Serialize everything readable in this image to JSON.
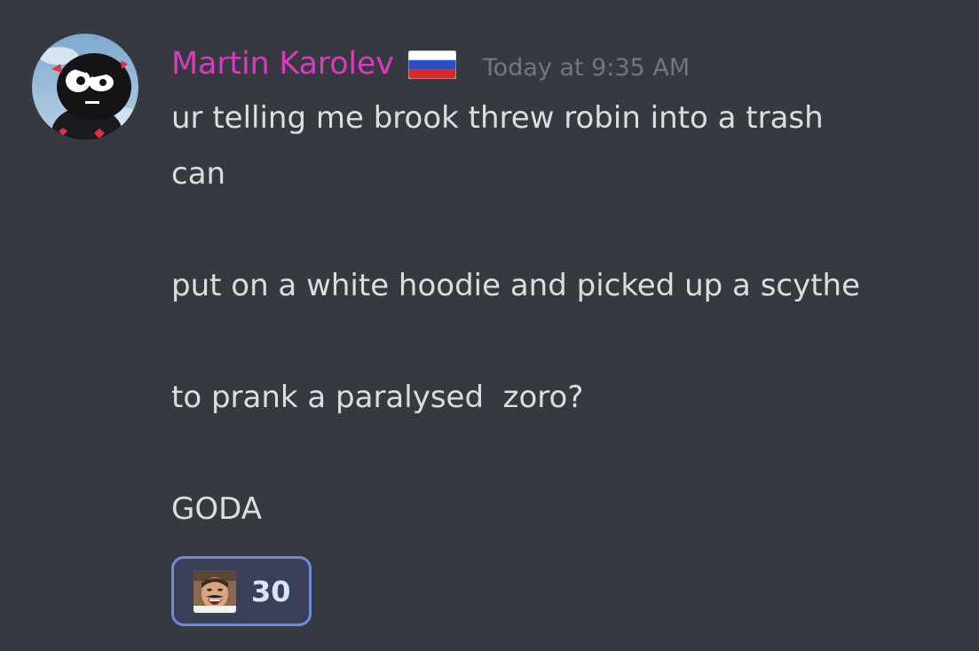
{
  "message": {
    "author": "Martin Karolev",
    "author_color": "#d83bbd",
    "badge_icon": "russia-flag-emoji",
    "timestamp": "Today at 9:35 AM",
    "lines": [
      "ur telling me brook threw robin into a trash",
      "can",
      "",
      "put on a white hoodie and picked up a scythe",
      "",
      "to prank a paralysed  zoro?",
      "",
      "GODA"
    ]
  },
  "reaction": {
    "emoji_icon": "laughing-man-emoji",
    "count": "30",
    "border_color": "#7289da"
  },
  "colors": {
    "background": "#36393f",
    "text": "#dcddde",
    "timestamp": "#72767d"
  }
}
